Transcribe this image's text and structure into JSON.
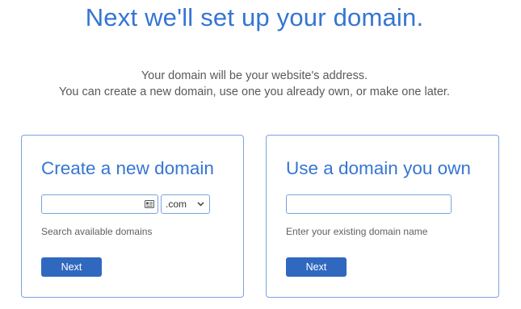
{
  "header": {
    "title": "Next we'll set up your domain.",
    "subtitle_line1": "Your domain will be your website's address.",
    "subtitle_line2": "You can create a new domain, use one you already own, or make one later."
  },
  "new_domain_card": {
    "title": "Create a new domain",
    "input_value": "",
    "input_icon": "contact-card-icon",
    "tld_selected": ".com",
    "helper_text": "Search available domains",
    "button_label": "Next"
  },
  "own_domain_card": {
    "title": "Use a domain you own",
    "input_value": "",
    "helper_text": "Enter your existing domain name",
    "button_label": "Next"
  },
  "colors": {
    "accent": "#3575d3",
    "border": "#7ba2de",
    "button": "#3068c0",
    "muted_text": "#5f5f5f"
  }
}
